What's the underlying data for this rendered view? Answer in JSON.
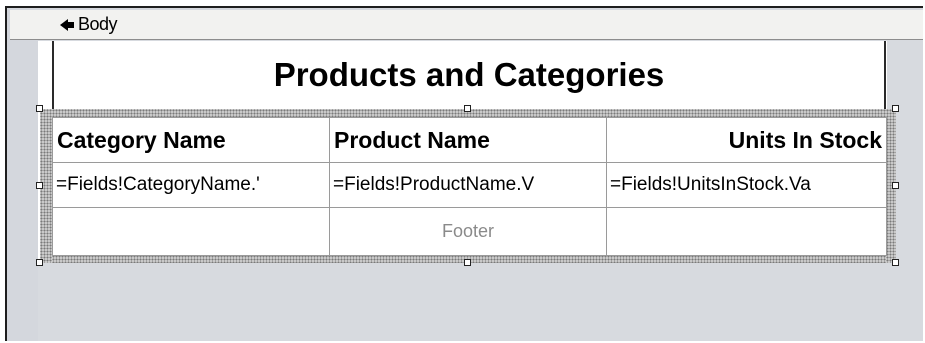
{
  "body_tab": {
    "label": "Body",
    "icon": "arrow-left-icon"
  },
  "report": {
    "title": "Products and Categories",
    "columns": [
      "Category Name",
      "Product Name",
      "Units In Stock"
    ],
    "detail": [
      "=Fields!CategoryName.'",
      "=Fields!ProductName.V",
      "=Fields!UnitsInStock.Va"
    ],
    "footer": [
      "",
      "Footer",
      ""
    ]
  }
}
